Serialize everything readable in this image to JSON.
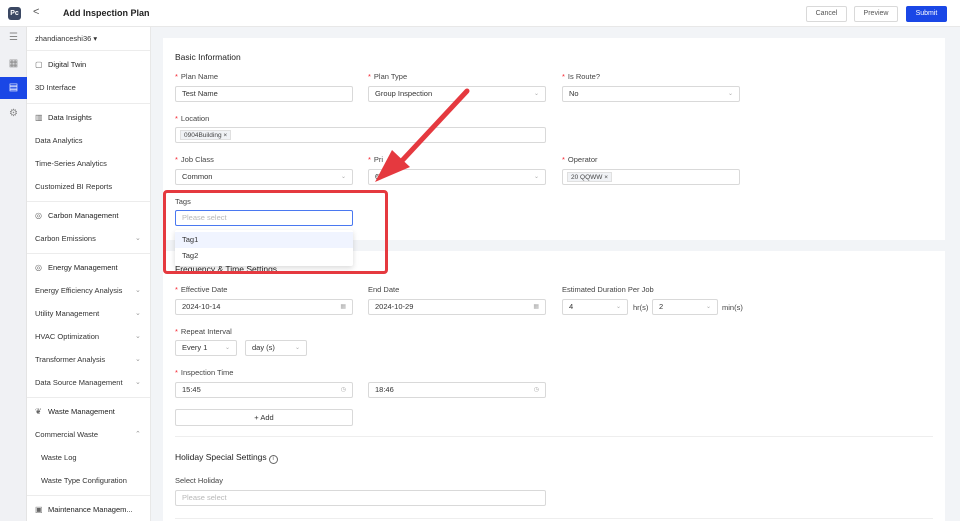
{
  "header": {
    "logo": "Pc",
    "back": "<",
    "title": "Add Inspection Plan",
    "cancel": "Cancel",
    "preview": "Preview",
    "submit": "Submit"
  },
  "rail": {
    "icons": [
      "menu-icon",
      "building-icon",
      "document-icon",
      "settings-icon"
    ]
  },
  "sidebar": {
    "user": "zhandianceshi36 ▾",
    "items": [
      {
        "label": "Digital Twin",
        "type": "group"
      },
      {
        "label": "3D Interface",
        "type": "item"
      },
      {
        "label": "Data Insights",
        "type": "group"
      },
      {
        "label": "Data Analytics",
        "type": "item"
      },
      {
        "label": "Time-Series Analytics",
        "type": "item"
      },
      {
        "label": "Customized BI Reports",
        "type": "item"
      },
      {
        "label": "Carbon Management",
        "type": "group"
      },
      {
        "label": "Carbon Emissions",
        "type": "item"
      },
      {
        "label": "Energy Management",
        "type": "group"
      },
      {
        "label": "Energy Efficiency Analysis",
        "type": "item"
      },
      {
        "label": "Utility Management",
        "type": "item"
      },
      {
        "label": "HVAC Optimization",
        "type": "item"
      },
      {
        "label": "Transformer Analysis",
        "type": "item"
      },
      {
        "label": "Data Source Management",
        "type": "item"
      },
      {
        "label": "Waste Management",
        "type": "group"
      },
      {
        "label": "Commercial Waste",
        "type": "item"
      },
      {
        "label": "Waste Log",
        "type": "sub"
      },
      {
        "label": "Waste Type Configuration",
        "type": "sub"
      },
      {
        "label": "Maintenance Managem...",
        "type": "group"
      }
    ]
  },
  "basic": {
    "section": "Basic Information",
    "plan_name": {
      "label": "Plan Name",
      "value": "Test Name"
    },
    "plan_type": {
      "label": "Plan Type",
      "value": "Group Inspection"
    },
    "is_route": {
      "label": "Is Route?",
      "value": "No"
    },
    "location": {
      "label": "Location",
      "tag": "0904Building"
    },
    "job_class": {
      "label": "Job Class",
      "value": "Common"
    },
    "priority": {
      "label": "Pri",
      "value": "6"
    },
    "operator": {
      "label": "Operator",
      "tag": "20 QQWW"
    },
    "tags": {
      "label": "Tags",
      "placeholder": "Please select",
      "options": [
        "Tag1",
        "Tag2"
      ]
    }
  },
  "freq": {
    "section": "Frequency & Time Settings",
    "effective_date": {
      "label": "Effective Date",
      "value": "2024-10-14"
    },
    "end_date": {
      "label": "End Date",
      "value": "2024-10-29"
    },
    "duration": {
      "label": "Estimated Duration Per Job",
      "hours": "4",
      "hours_unit": "hr(s)",
      "minutes": "2",
      "minutes_unit": "min(s)"
    },
    "repeat": {
      "label": "Repeat Interval",
      "every": "Every 1",
      "unit": "day (s)"
    },
    "inspection_time": {
      "label": "Inspection Time",
      "t1": "15:45",
      "t2": "18:46"
    },
    "add": "Add"
  },
  "holiday": {
    "section": "Holiday Special Settings",
    "select_label": "Select Holiday",
    "placeholder": "Please select"
  },
  "colors": {
    "accent": "#1a47e6",
    "annotation": "#e5393f",
    "required": "#f5222d"
  }
}
